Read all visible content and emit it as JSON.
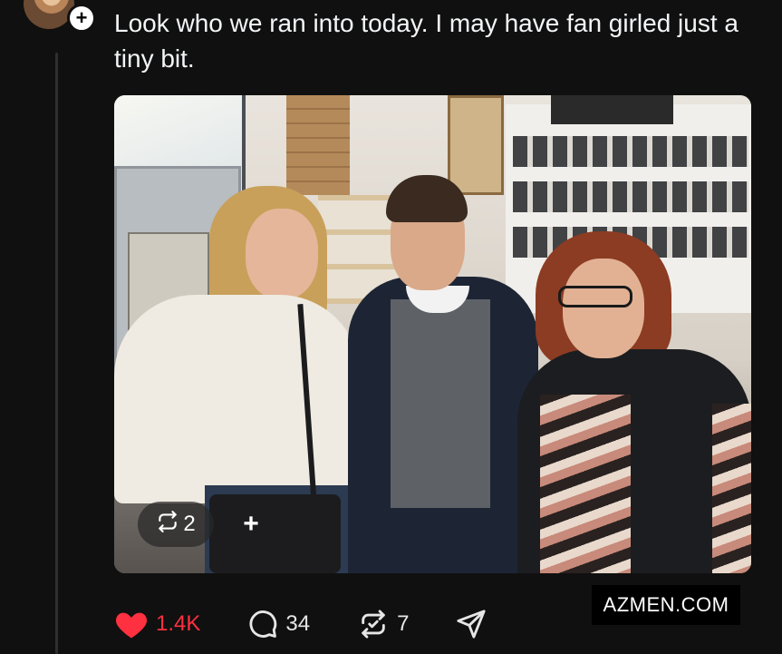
{
  "post": {
    "text": "Look who we ran into today. I may have fan girled just a tiny bit."
  },
  "follow_badge": "+",
  "media_overlay": {
    "repost_count": "2",
    "add_label": "+"
  },
  "actions": {
    "likes": "1.4K",
    "replies": "34",
    "reposts": "7"
  },
  "watermark": "AZMEN.COM",
  "colors": {
    "background": "#101010",
    "like": "#ff3040",
    "text": "#f3f5f7"
  },
  "icons": [
    "heart-icon",
    "comment-icon",
    "repost-icon",
    "share-icon",
    "plus-icon"
  ]
}
